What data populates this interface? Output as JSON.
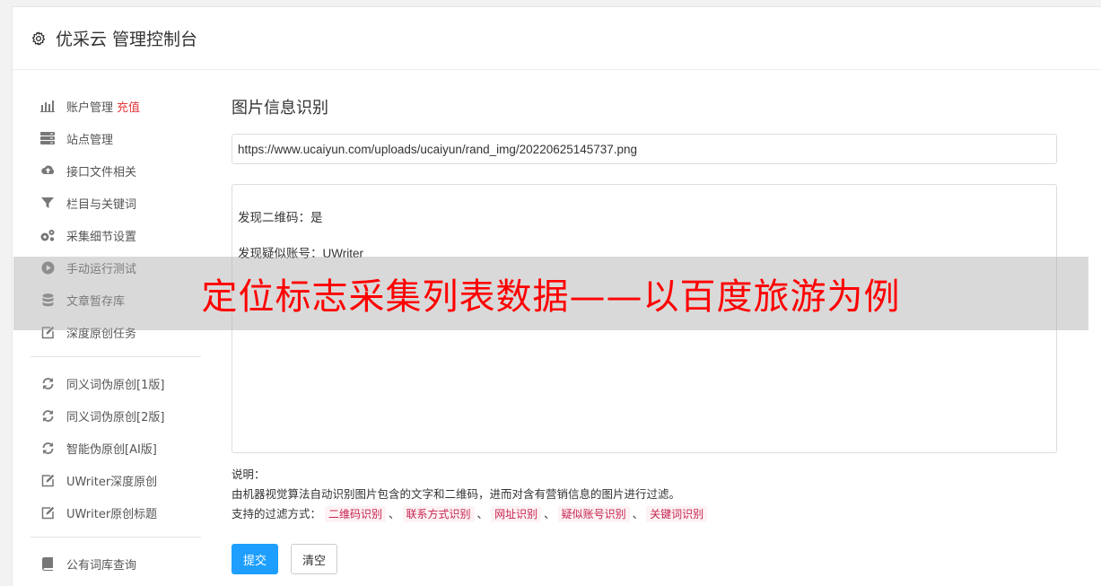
{
  "header": {
    "title": "优采云 管理控制台"
  },
  "sidebar": {
    "group1": [
      {
        "label": "账户管理",
        "badge": "充值",
        "icon": "bar-chart-icon"
      },
      {
        "label": "站点管理",
        "icon": "server-icon"
      },
      {
        "label": "接口文件相关",
        "icon": "cloud-upload-icon"
      },
      {
        "label": "栏目与关键词",
        "icon": "filter-icon"
      },
      {
        "label": "采集细节设置",
        "icon": "gears-icon"
      },
      {
        "label": "手动运行测试",
        "icon": "play-circle-icon"
      },
      {
        "label": "文章暂存库",
        "icon": "database-icon"
      },
      {
        "label": "深度原创任务",
        "icon": "edit-icon"
      }
    ],
    "group2": [
      {
        "label": "同义词伪原创[1版]",
        "icon": "refresh-icon"
      },
      {
        "label": "同义词伪原创[2版]",
        "icon": "refresh-icon"
      },
      {
        "label": "智能伪原创[AI版]",
        "icon": "refresh-icon"
      },
      {
        "label": "UWriter深度原创",
        "icon": "edit-icon"
      },
      {
        "label": "UWriter原创标题",
        "icon": "edit-icon"
      }
    ],
    "group3": [
      {
        "label": "公有词库查询",
        "icon": "book-icon"
      }
    ]
  },
  "main": {
    "title": "图片信息识别",
    "url_value": "https://www.ucaiyun.com/uploads/ucaiyun/rand_img/20220625145737.png",
    "result_lines": [
      "发现二维码：是",
      "发现疑似账号：UWriter"
    ],
    "explain_title": "说明：",
    "explain_desc": "由机器视觉算法自动识别图片包含的文字和二维码，进而对含有营销信息的图片进行过滤。",
    "filter_label": "支持的过滤方式：",
    "filter_tags": [
      "二维码识别",
      "联系方式识别",
      "网址识别",
      "疑似账号识别",
      "关键词识别"
    ],
    "separator": "、",
    "submit_label": "提交",
    "clear_label": "清空"
  },
  "overlay": {
    "text": "定位标志采集列表数据——以百度旅游为例"
  },
  "colors": {
    "accent": "#1e9fff",
    "badge": "#e4393c",
    "tag_text": "#c7254e",
    "overlay_text": "#ff0000"
  }
}
